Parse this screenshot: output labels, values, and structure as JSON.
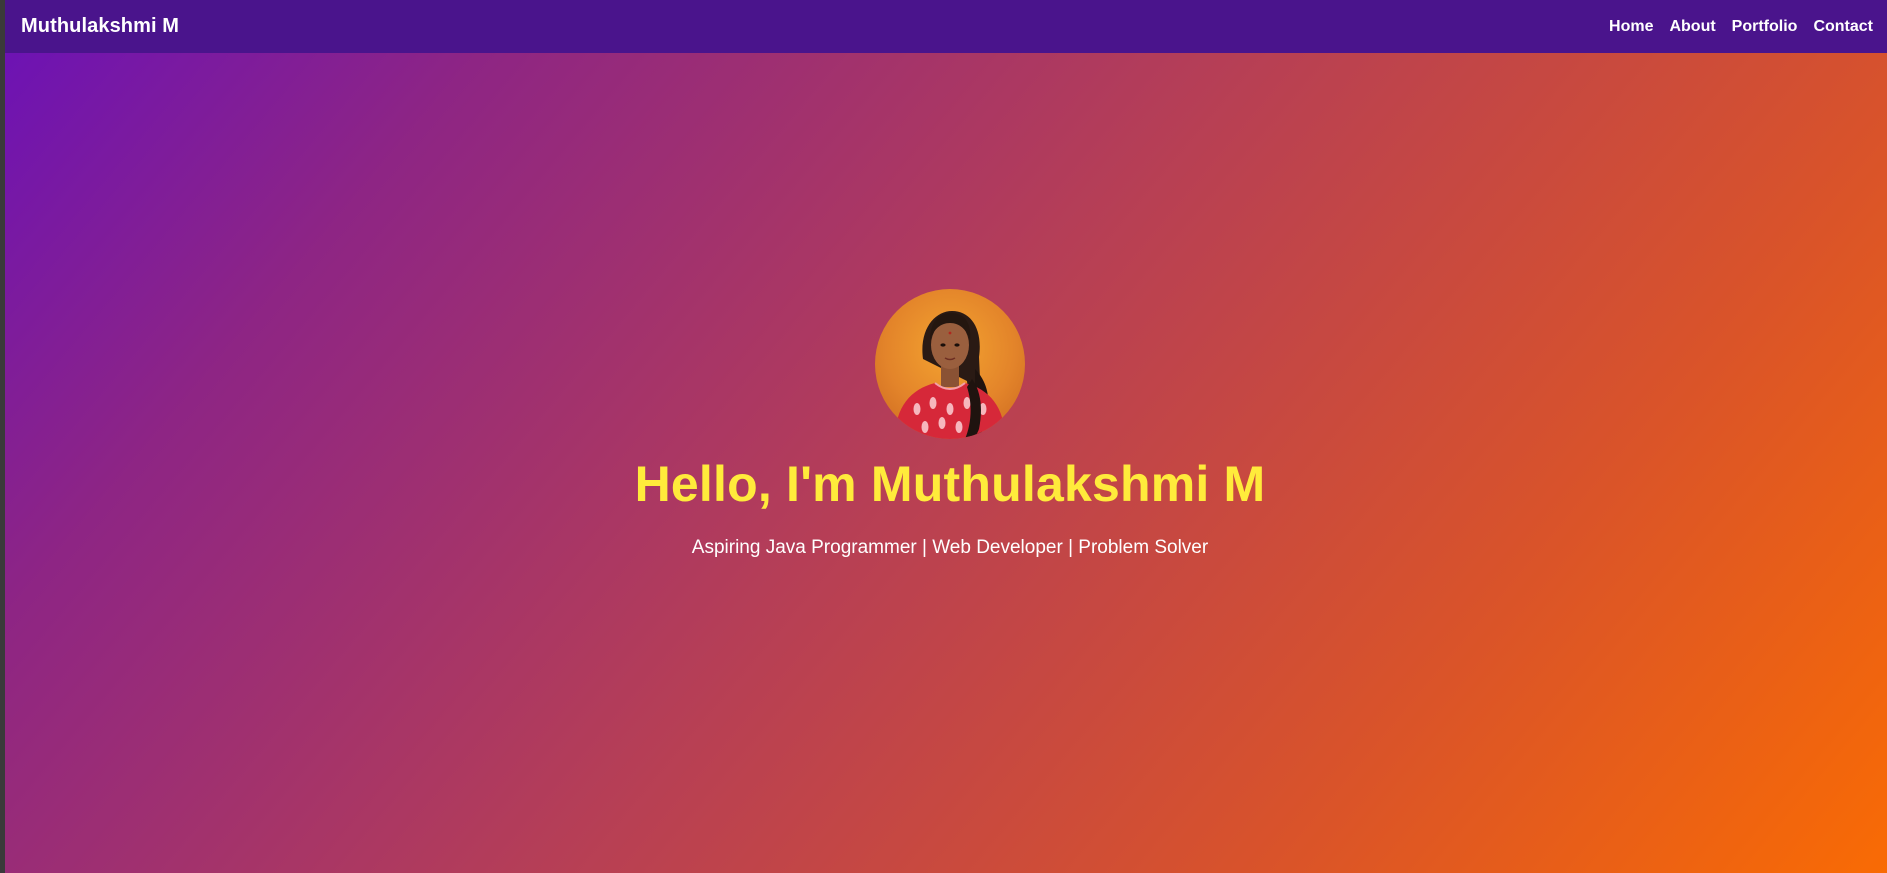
{
  "navbar": {
    "brand": "Muthulakshmi M",
    "links": [
      {
        "label": "Home"
      },
      {
        "label": "About"
      },
      {
        "label": "Portfolio"
      },
      {
        "label": "Contact"
      }
    ],
    "background_color": "#4a148c"
  },
  "hero": {
    "title": "Hello, I'm Muthulakshmi M",
    "subtitle": "Aspiring Java Programmer | Web Developer | Problem Solver",
    "title_color": "#ffeb3b",
    "gradient_colors": [
      "#6a11b8",
      "#f96b04"
    ]
  }
}
